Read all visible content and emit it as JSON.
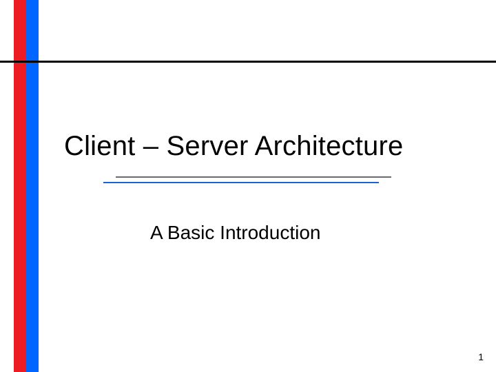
{
  "slide": {
    "title": "Client – Server Architecture",
    "subtitle": "A Basic Introduction",
    "page_number": "1"
  },
  "colors": {
    "red_stripe": "#ed1c24",
    "blue_stripe": "#0066ff",
    "top_rule": "#000000",
    "mid_rule_top": "#6b6b6b",
    "mid_rule_bottom": "#1c62d6"
  }
}
